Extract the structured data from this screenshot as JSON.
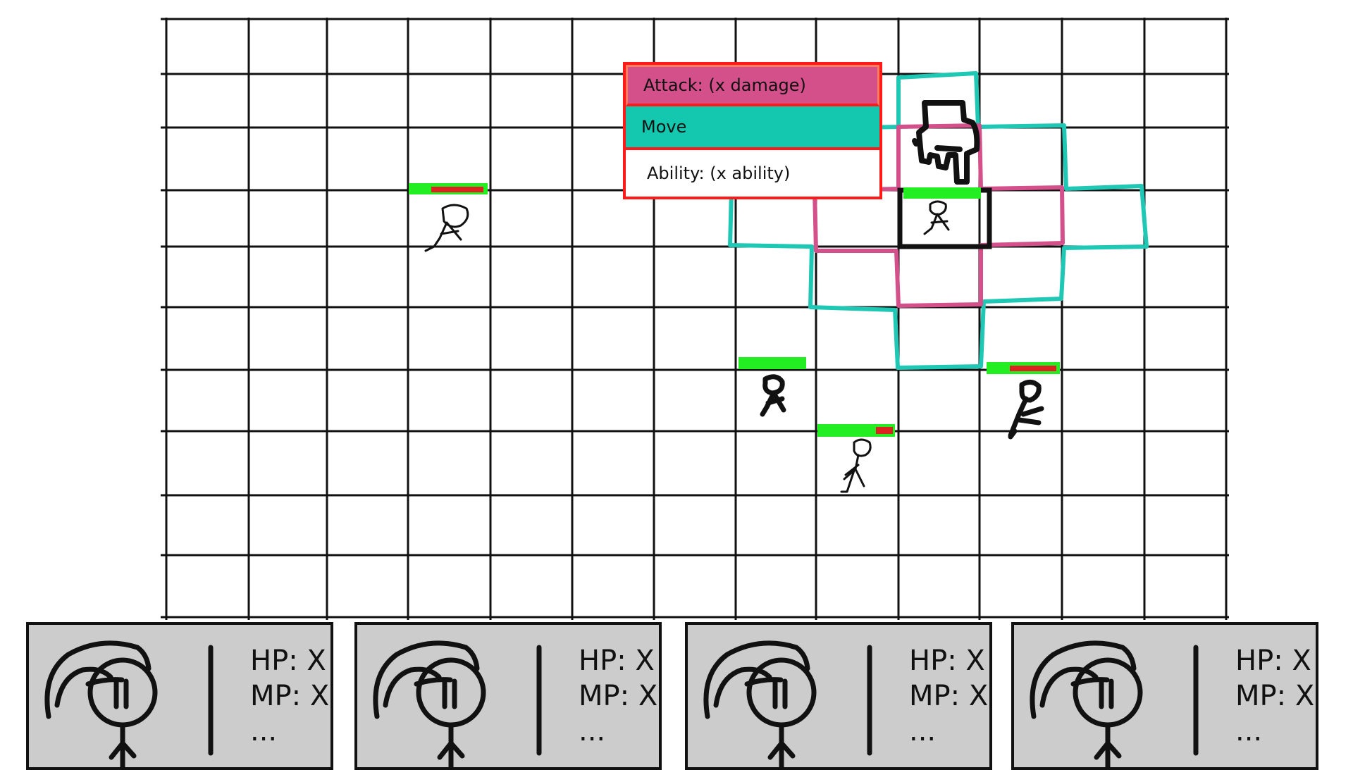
{
  "colors": {
    "grid": "#111111",
    "move_range": "#1ec8b4",
    "attack_range": "#d4508a",
    "hp_bar": "#22ee22",
    "damage_bar": "#dd2222",
    "menu_border": "#ff1a1a",
    "menu_attack_bg": "#d4508a",
    "menu_move_bg": "#14c8b0",
    "panel_bg": "#cccccc"
  },
  "action_menu": {
    "items": [
      {
        "label": "Attack: (x damage)",
        "color": "#d4508a"
      },
      {
        "label": "Move",
        "color": "#14c8b0"
      },
      {
        "label": "Ability: (x ability)",
        "color": "#ffffff"
      }
    ]
  },
  "units": [
    {
      "name": "enemy",
      "hp_fraction": 0.3
    },
    {
      "name": "selected-hero",
      "hp_fraction": 1.0
    },
    {
      "name": "ally",
      "hp_fraction": 1.0
    },
    {
      "name": "hero",
      "hp_fraction": 0.75
    },
    {
      "name": "enemy",
      "hp_fraction": 0.3
    }
  ],
  "party": [
    {
      "hp": "HP: X",
      "mp": "MP: X",
      "more": "..."
    },
    {
      "hp": "HP: X",
      "mp": "MP: X",
      "more": "..."
    },
    {
      "hp": "HP: X",
      "mp": "MP: X",
      "more": "..."
    },
    {
      "hp": "HP: X",
      "mp": "MP: X",
      "more": "..."
    }
  ],
  "icons": {
    "cursor": "pointing-hand-icon",
    "portrait": "stick-figure-portrait-icon"
  }
}
